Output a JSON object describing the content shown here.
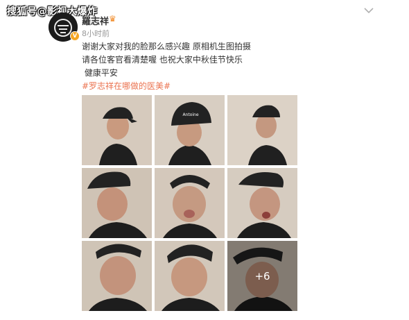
{
  "watermark": "搜狐号@影视大爆炸",
  "post": {
    "username": "羅志祥",
    "time": "8小时前",
    "lines": [
      "谢谢大家对我的脸那么感兴趣 原相机生图拍摄",
      "请各位客官看清楚喔 也祝大家中秋佳节快乐",
      " 健康平安"
    ],
    "hashtag": "#罗志祥在哪做的医美#",
    "more_count": "+6"
  },
  "colors": {
    "hashtag": "#eb7350",
    "badge": "#f5a623",
    "wall": "#d9cfc3"
  },
  "icons": [
    "avatar-logo",
    "verified-badge",
    "crown-icon",
    "chevron-down-icon"
  ]
}
